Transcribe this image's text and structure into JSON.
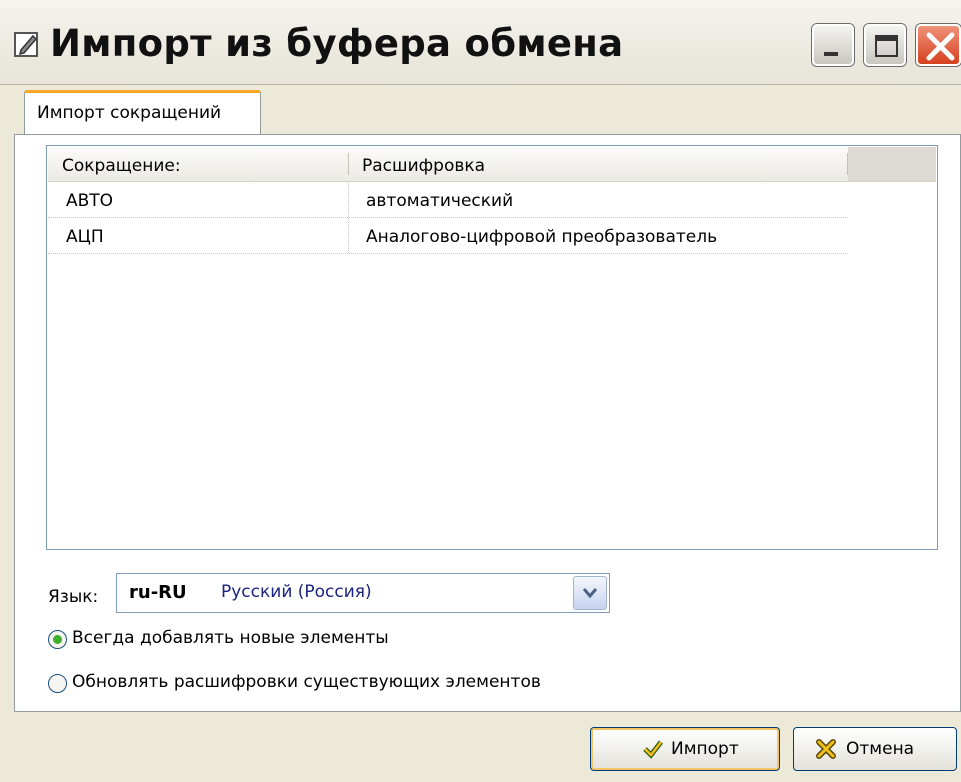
{
  "window": {
    "title": "Импорт из буфера обмена"
  },
  "tabs": [
    {
      "label": "Импорт сокращений",
      "active": true
    }
  ],
  "grid": {
    "columns": [
      "Сокращение:",
      "Расшифровка"
    ],
    "rows": [
      {
        "abbr": "АВТО",
        "expansion": "автоматический"
      },
      {
        "abbr": "АЦП",
        "expansion": "Аналогово-цифровой преобразователь"
      }
    ]
  },
  "language": {
    "label": "Язык:",
    "code": "ru-RU",
    "name": "Русский (Россия)"
  },
  "options": [
    {
      "label": "Всегда добавлять новые элементы",
      "selected": true
    },
    {
      "label": "Обновлять расшифровки существующих элементов",
      "selected": false
    }
  ],
  "buttons": {
    "import_label": "Импорт",
    "cancel_label": "Отмена"
  },
  "colors": {
    "window_bg": "#ece9d8",
    "tab_accent": "#f7a627",
    "close_button": "#d6401f",
    "radio_selected": "#3fae2a",
    "language_name": "#1a237e"
  },
  "icons": {
    "title": "edit-document-icon",
    "minimize": "minimize-icon",
    "maximize": "maximize-icon",
    "close": "close-icon",
    "combo": "chevron-down-icon",
    "import": "checkmark-icon",
    "cancel": "cross-icon"
  }
}
